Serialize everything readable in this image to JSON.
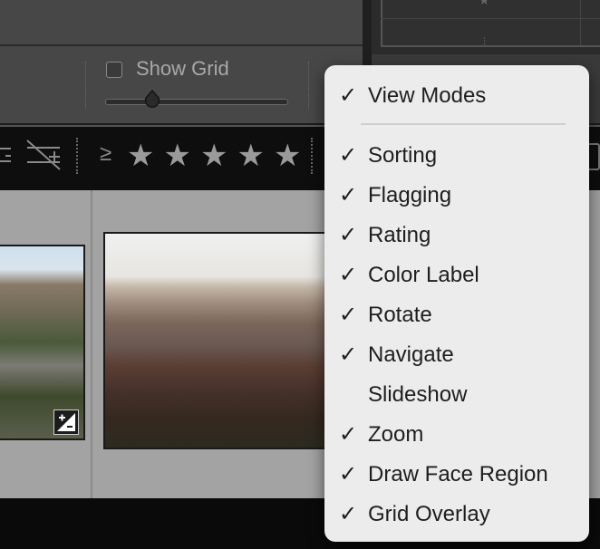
{
  "grid_controls": {
    "show_grid_label": "Show Grid",
    "show_grid_checked": false
  },
  "toolbar": {
    "rating_operator": "≥",
    "stars": [
      "★",
      "★",
      "★",
      "★",
      "★"
    ]
  },
  "menu": {
    "items": [
      {
        "label": "View Modes",
        "checked": true
      },
      {
        "label": "Sorting",
        "checked": true
      },
      {
        "label": "Flagging",
        "checked": true
      },
      {
        "label": "Rating",
        "checked": true
      },
      {
        "label": "Color Label",
        "checked": true
      },
      {
        "label": "Rotate",
        "checked": true
      },
      {
        "label": "Navigate",
        "checked": true
      },
      {
        "label": "Slideshow",
        "checked": false
      },
      {
        "label": "Zoom",
        "checked": true
      },
      {
        "label": "Draw Face Region",
        "checked": true
      },
      {
        "label": "Grid Overlay",
        "checked": true
      }
    ],
    "check_glyph": "✓"
  }
}
